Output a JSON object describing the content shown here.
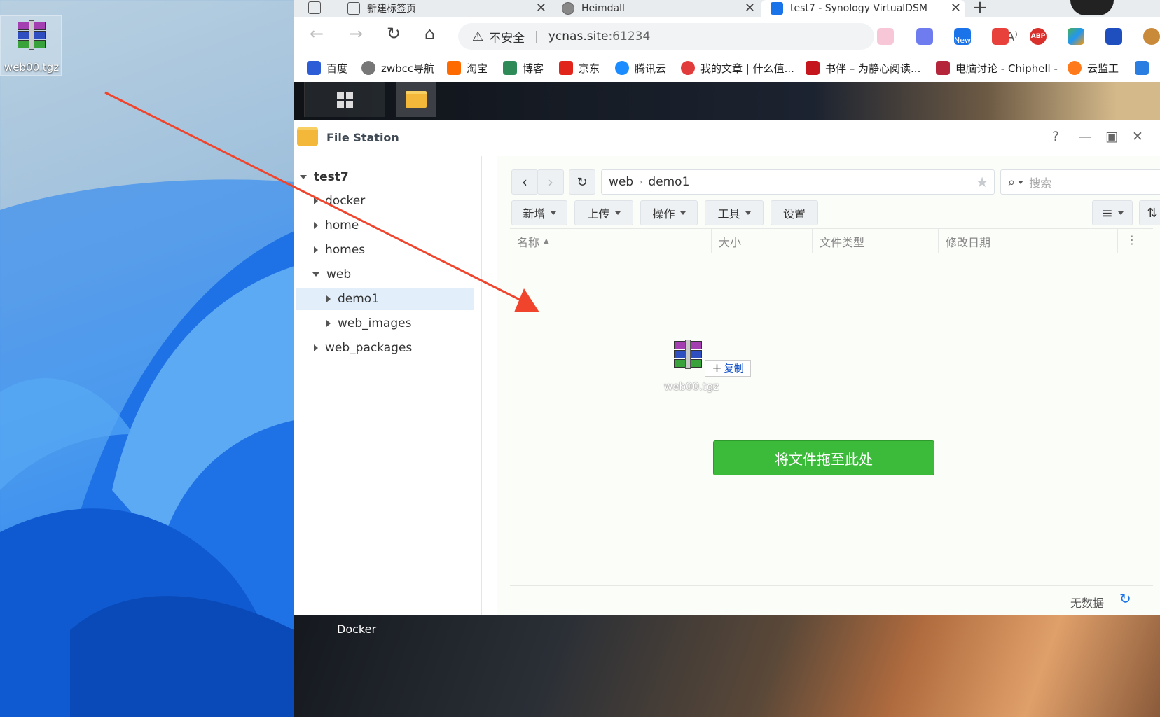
{
  "desktop": {
    "file_label": "web00.tgz"
  },
  "browser": {
    "tabs": [
      {
        "label": "新建标签页"
      },
      {
        "label": "Heimdall"
      },
      {
        "label": "test7 - Synology VirtualDSM"
      }
    ],
    "address": {
      "security": "不安全",
      "host": "ycnas.site",
      "port": ":61234"
    },
    "ext_new_badge": "New",
    "ext_abp": "ABP",
    "bookmarks": [
      "百度",
      "zwbcc导航",
      "淘宝",
      "博客",
      "京东",
      "腾讯云",
      "我的文章 | 什么值...",
      "书伴 – 为静心阅读...",
      "电脑讨论 - Chiphell -",
      "云监工"
    ]
  },
  "filestation": {
    "title": "File Station",
    "tree": {
      "root": "test7",
      "items": [
        "docker",
        "home",
        "homes",
        "web",
        "demo1",
        "web_images",
        "web_packages"
      ]
    },
    "path": {
      "seg1": "web",
      "seg2": "demo1"
    },
    "search_placeholder": "搜索",
    "toolbar": {
      "new": "新增",
      "upload": "上传",
      "action": "操作",
      "tools": "工具",
      "settings": "设置"
    },
    "columns": [
      "名称",
      "大小",
      "文件类型",
      "修改日期"
    ],
    "drag_file": "web00.tgz",
    "copy_tip": "复制",
    "drop_label": "将文件拖至此处",
    "status": "无数据"
  },
  "taskbar": {
    "docker_label": "Docker"
  },
  "colors": {
    "accent": "#3cba3a",
    "arrow": "#f0442c"
  }
}
